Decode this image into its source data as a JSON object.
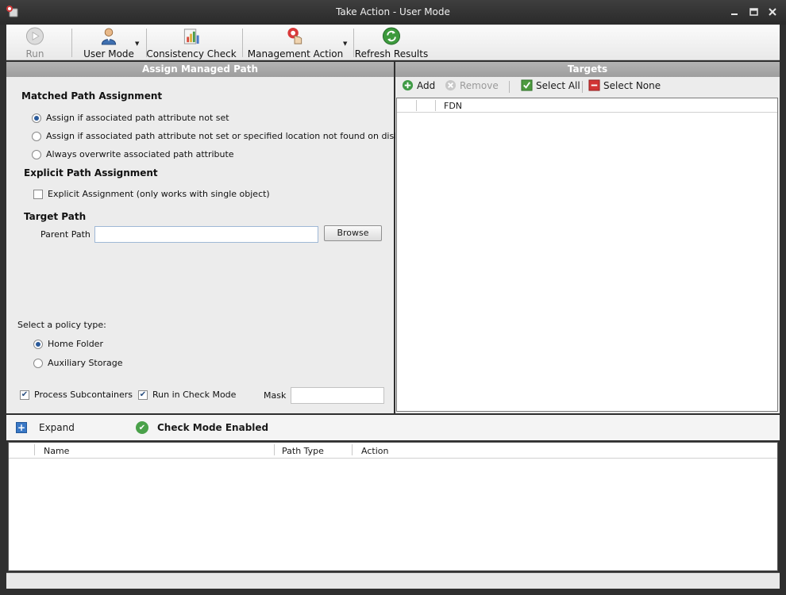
{
  "window": {
    "title": "Take Action - User Mode"
  },
  "toolbar": {
    "run_label": "Run",
    "user_mode_label": "User Mode",
    "consistency_check_label": "Consistency Check",
    "management_action_label": "Management Action",
    "refresh_results_label": "Refresh Results"
  },
  "assign_panel": {
    "header": "Assign Managed Path",
    "matched_title": "Matched Path Assignment",
    "matched_options": [
      "Assign if associated path attribute not set",
      "Assign if associated path attribute not set or specified location not found on disk",
      "Always overwrite associated path attribute"
    ],
    "matched_selected_index": 0,
    "explicit_title": "Explicit Path Assignment",
    "explicit_checkbox_label": "Explicit Assignment (only works with single object)",
    "explicit_checked": false,
    "target_path_title": "Target Path",
    "parent_path_label": "Parent Path",
    "parent_path_value": "",
    "browse_label": "Browse",
    "policy_type_label": "Select a policy type:",
    "policy_options": [
      "Home Folder",
      "Auxiliary Storage"
    ],
    "policy_selected_index": 0,
    "process_subcontainers_label": "Process Subcontainers",
    "process_subcontainers_checked": true,
    "run_check_mode_label": "Run in Check Mode",
    "run_check_mode_checked": true,
    "mask_label": "Mask",
    "mask_value": ""
  },
  "targets_panel": {
    "header": "Targets",
    "add_label": "Add",
    "remove_label": "Remove",
    "select_all_label": "Select All",
    "select_none_label": "Select None",
    "columns": [
      "",
      "",
      "FDN"
    ]
  },
  "results": {
    "expand_label": "Expand",
    "check_mode_status": "Check Mode Enabled",
    "columns": [
      "",
      "Name",
      "Path Type",
      "Action"
    ]
  }
}
